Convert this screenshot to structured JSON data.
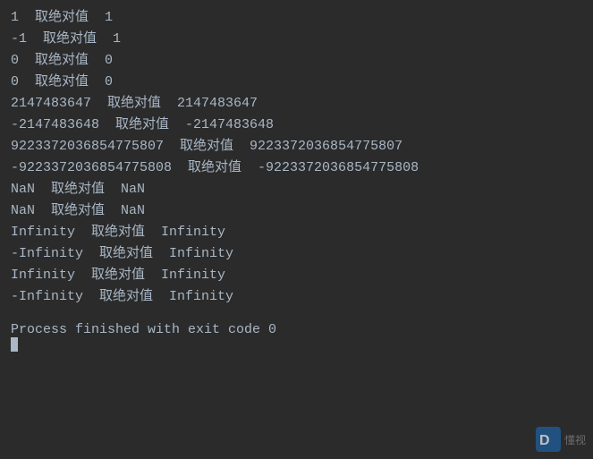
{
  "terminal": {
    "lines": [
      {
        "input": "1",
        "label": "取绝对值",
        "output": "1"
      },
      {
        "input": "-1",
        "label": "取绝对值",
        "output": "1"
      },
      {
        "input": "0",
        "label": "取绝对值",
        "output": "0"
      },
      {
        "input": "0",
        "label": "取绝对值",
        "output": "0"
      },
      {
        "input": "2147483647",
        "label": "取绝对值",
        "output": "2147483647"
      },
      {
        "input": "-2147483648",
        "label": "取绝对值",
        "output": "-2147483648"
      },
      {
        "input": "9223372036854775807",
        "label": "取绝对值",
        "output": "9223372036854775807"
      },
      {
        "input": "-9223372036854775808",
        "label": "取绝对值",
        "output": "-9223372036854775808"
      },
      {
        "input": "NaN",
        "label": "取绝对值",
        "output": "NaN"
      },
      {
        "input": "NaN",
        "label": "取绝对值",
        "output": "NaN"
      },
      {
        "input": "Infinity",
        "label": "取绝对值",
        "output": "Infinity"
      },
      {
        "input": "-Infinity",
        "label": "取绝对值",
        "output": "Infinity"
      },
      {
        "input": "Infinity",
        "label": "取绝对值",
        "output": "Infinity"
      },
      {
        "input": "-Infinity",
        "label": "取绝对值",
        "output": "Infinity"
      }
    ],
    "process_line": "Process finished with exit code 0",
    "watermark_text": "懂视"
  }
}
